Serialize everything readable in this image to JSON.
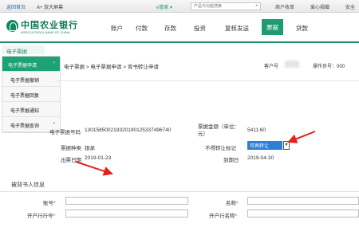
{
  "util_bar": {
    "back_home": "返回首页",
    "font_size": "A+ 放大屏幕",
    "e_steward": "e管家 ▾",
    "search_placeholder": "产品与功能搜索",
    "merchant": "商户收单",
    "favorites": "爱心捐赠",
    "security": "安全"
  },
  "header": {
    "logo_cn": "中国农业银行",
    "logo_en": "AGRICULTURAL BANK OF CHINA",
    "nav": [
      "账户",
      "付款",
      "存款",
      "投资",
      "复核发送",
      "票据",
      "贷款"
    ],
    "active_nav": "票据"
  },
  "left_menu": {
    "title": "电子票据",
    "items": [
      {
        "label": "电子票据申请",
        "arrow": "›"
      },
      {
        "label": "电子票据撤销",
        "arrow": ""
      },
      {
        "label": "电子票据回复",
        "arrow": ""
      },
      {
        "label": "电子票据通知",
        "arrow": ""
      },
      {
        "label": "电子票据查询",
        "arrow": "›"
      }
    ]
  },
  "breadcrumb": "电子票据 > 电子票据申请 > 背书转让申请",
  "customer_label": "客户号",
  "operator_label": "操作员号：000",
  "bill": {
    "bill_no_label": "电子票据号码",
    "bill_no": "130158500219320190125337496740",
    "amount_label": "票据金额（单位：元）",
    "amount": "5411.60",
    "type_label": "票据种类",
    "type": "银承",
    "transfer_label": "不得转让标记",
    "transfer_value": "可再转让",
    "issue_label": "出票日期",
    "issue_date": "2019-01-23",
    "due_label": "到期日",
    "due_date": "2019-04-30"
  },
  "endorsee": {
    "section_title": "被背书人信息",
    "account_label": "账号",
    "name_label": "名称",
    "bank_label": "开户行行号",
    "bank_name_label": "开户行名称",
    "required_mark": "*"
  },
  "colors": {
    "brand_green": "#1f9a72",
    "select_blue": "#2d7fd3",
    "annotation_red": "#e2231a"
  }
}
